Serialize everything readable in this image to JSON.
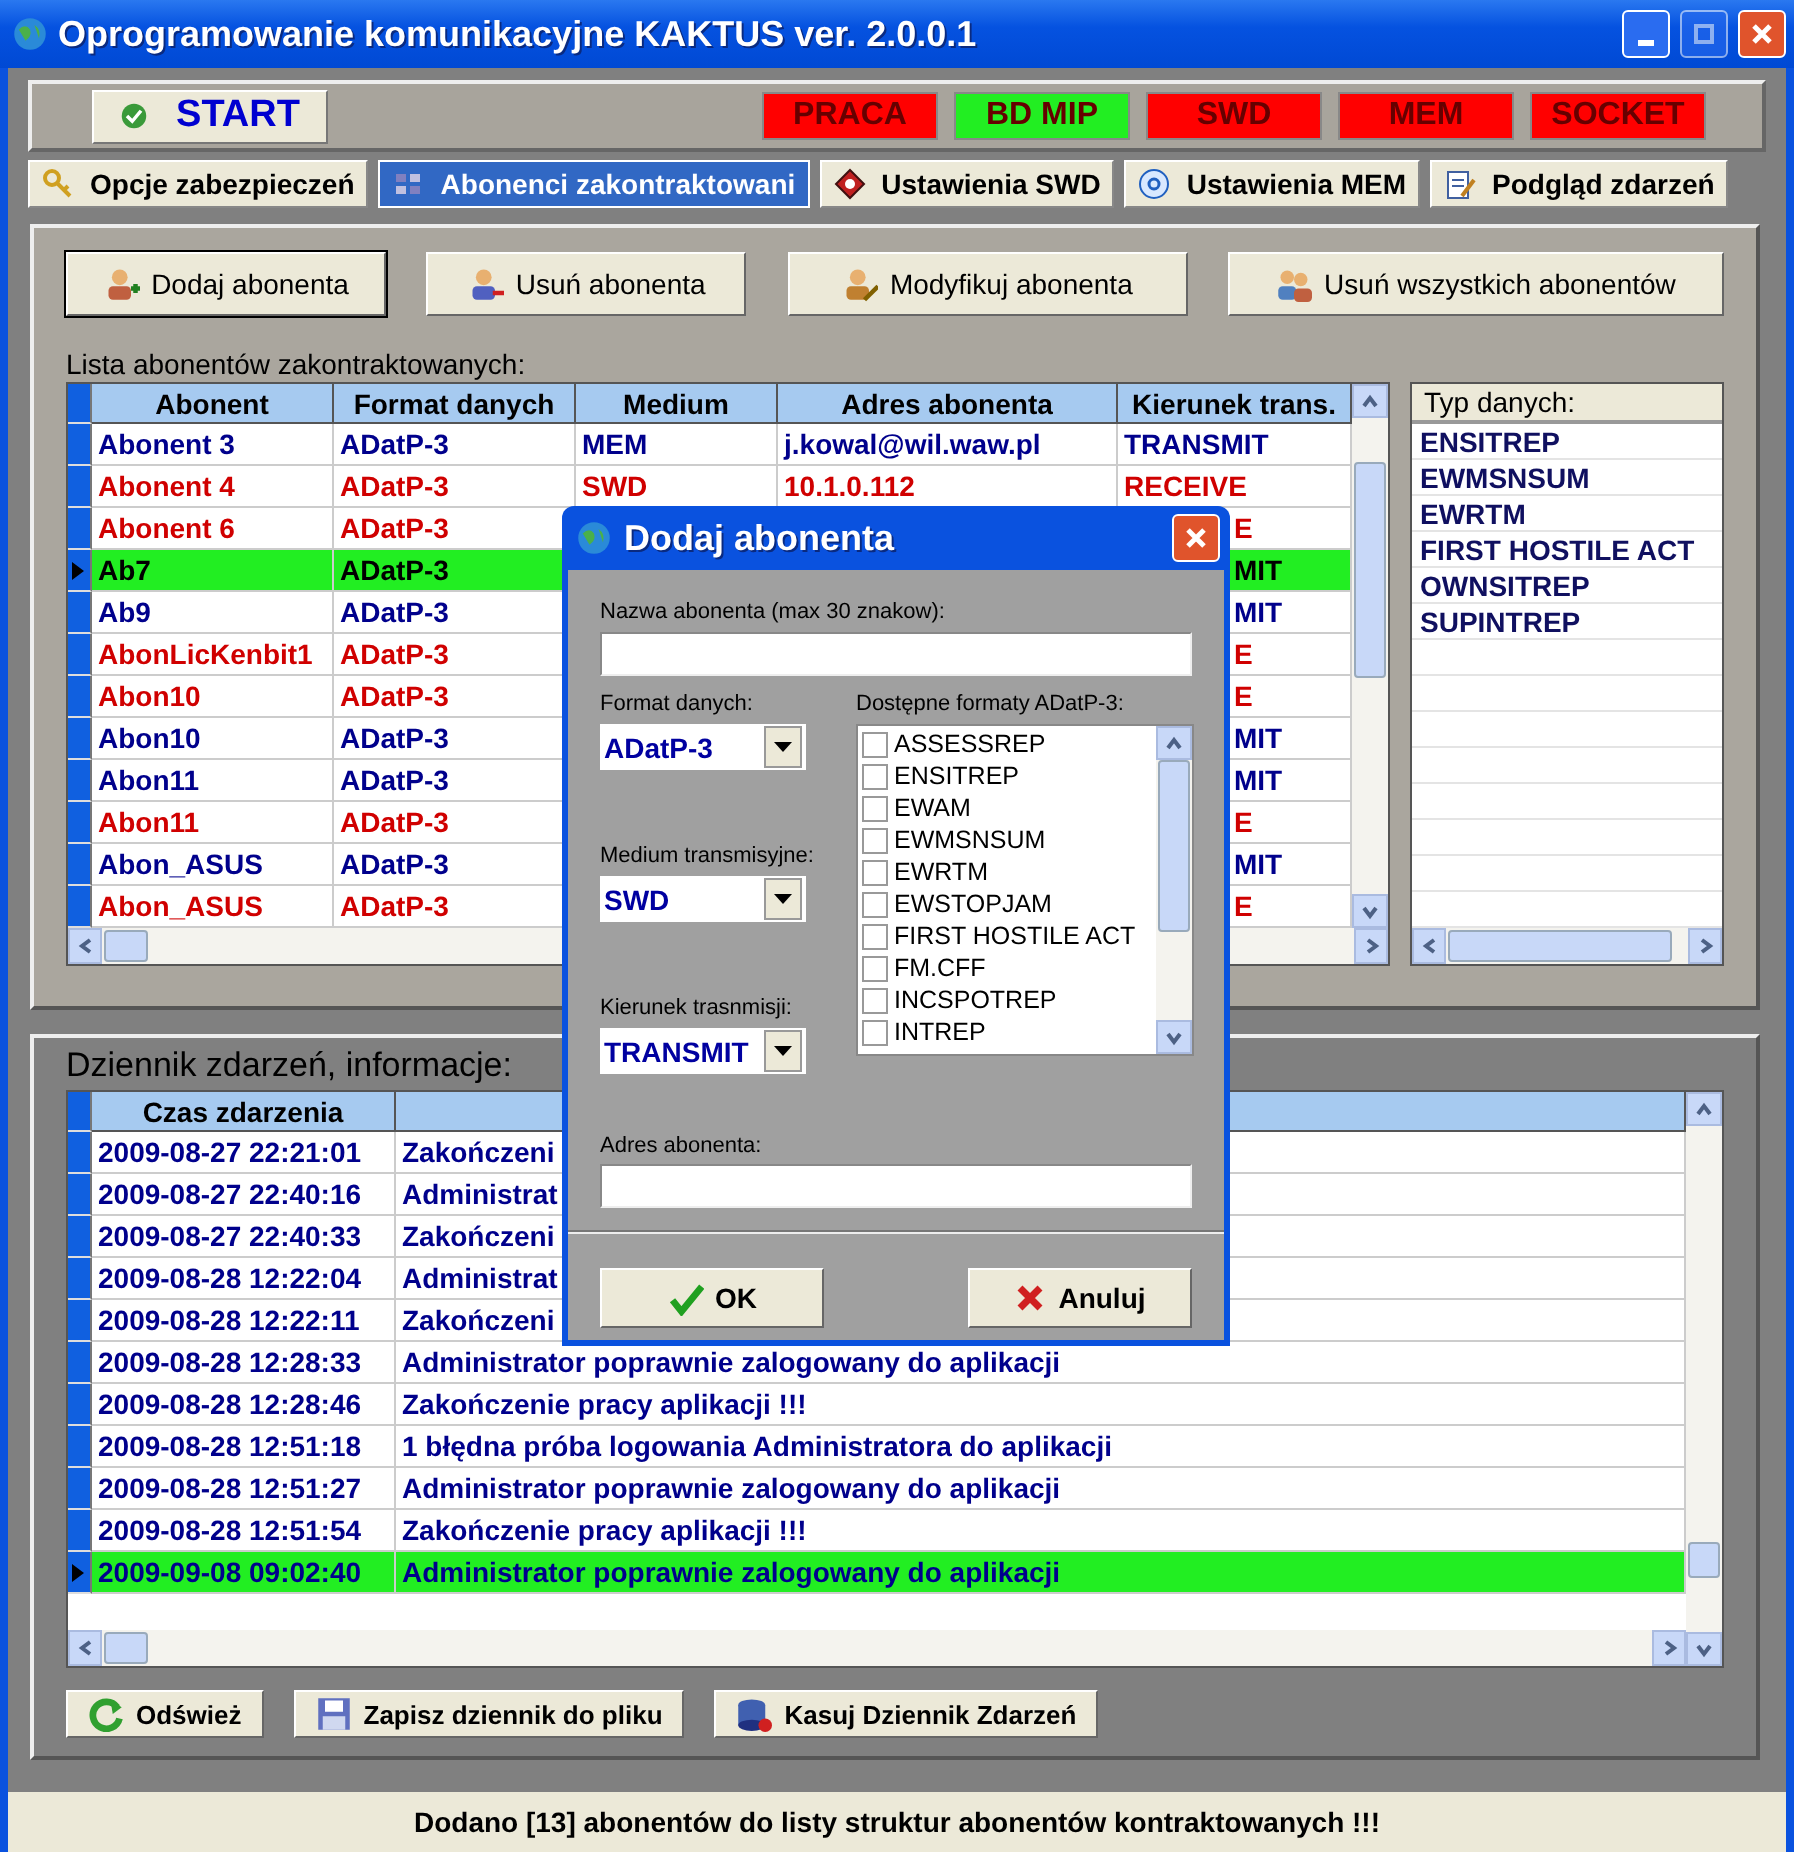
{
  "window": {
    "title": "Oprogramowanie komunikacyjne KAKTUS ver. 2.0.0.1"
  },
  "toolbar": {
    "start_button": "START",
    "indicators": [
      {
        "label": "PRACA",
        "active": false
      },
      {
        "label": "BD MIP",
        "active": true
      },
      {
        "label": "SWD",
        "active": false
      },
      {
        "label": "MEM",
        "active": false
      },
      {
        "label": "SOCKET",
        "active": false
      }
    ]
  },
  "tabs": [
    {
      "label": "Opcje zabezpieczeń",
      "selected": false
    },
    {
      "label": "Abonenci zakontraktowani",
      "selected": true
    },
    {
      "label": "Ustawienia SWD",
      "selected": false
    },
    {
      "label": "Ustawienia MEM",
      "selected": false
    },
    {
      "label": "Podgląd zdarzeń",
      "selected": false
    }
  ],
  "subscribers_panel": {
    "buttons": [
      "Dodaj abonenta",
      "Usuń abonenta",
      "Modyfikuj abonenta",
      "Usuń wszystkich abonentów"
    ],
    "list_label": "Lista abonentów zakontraktowanych:",
    "table": {
      "columns": [
        "Abonent",
        "Format danych",
        "Medium",
        "Adres abonenta",
        "Kierunek trans."
      ],
      "rows": [
        {
          "abonent": "Abonent 3",
          "format": "ADatP-3",
          "medium": "MEM",
          "address": "j.kowal@wil.waw.pl",
          "direction": "TRANSMIT",
          "color": "#00008c",
          "selected": false
        },
        {
          "abonent": "Abonent 4",
          "format": "ADatP-3",
          "medium": "SWD",
          "address": "10.1.0.112",
          "direction": "RECEIVE",
          "color": "#d00000",
          "selected": false
        },
        {
          "abonent": "Abonent 6",
          "format": "ADatP-3",
          "direction": "E",
          "color": "#d00000",
          "selected": false
        },
        {
          "abonent": "Ab7",
          "format": "ADatP-3",
          "direction": "MIT",
          "selected": true
        },
        {
          "abonent": "Ab9",
          "format": "ADatP-3",
          "direction": "MIT",
          "color": "#00008c",
          "selected": false
        },
        {
          "abonent": "AbonLicKenbit1",
          "format": "ADatP-3",
          "direction": "E",
          "color": "#d00000",
          "selected": false
        },
        {
          "abonent": "Abon10",
          "format": "ADatP-3",
          "direction": "E",
          "color": "#d00000",
          "selected": false
        },
        {
          "abonent": "Abon10",
          "format": "ADatP-3",
          "direction": "MIT",
          "color": "#00008c",
          "selected": false
        },
        {
          "abonent": "Abon11",
          "format": "ADatP-3",
          "direction": "MIT",
          "color": "#00008c",
          "selected": false
        },
        {
          "abonent": "Abon11",
          "format": "ADatP-3",
          "direction": "E",
          "color": "#d00000",
          "selected": false
        },
        {
          "abonent": "Abon_ASUS",
          "format": "ADatP-3",
          "direction": "MIT",
          "color": "#00008c",
          "selected": false
        },
        {
          "abonent": "Abon_ASUS",
          "format": "ADatP-3",
          "direction": "E",
          "color": "#d00000",
          "selected": false
        }
      ]
    },
    "data_types": {
      "title": "Typ danych:",
      "items": [
        "ENSITREP",
        "EWMSNSUM",
        "EWRTM",
        "FIRST HOSTILE ACT",
        "OWNSITREP",
        "SUPINTREP"
      ]
    }
  },
  "log_panel": {
    "title": "Dziennik zdarzeń, informacje:",
    "table": {
      "columns": [
        "Czas zdarzenia"
      ],
      "rows": [
        {
          "time": "2009-08-27 22:21:01",
          "message": "Zakończeni",
          "selected": false
        },
        {
          "time": "2009-08-27 22:40:16",
          "message": "Administrat",
          "selected": false
        },
        {
          "time": "2009-08-27 22:40:33",
          "message": "Zakończeni",
          "selected": false
        },
        {
          "time": "2009-08-28 12:22:04",
          "message": "Administrat",
          "selected": false
        },
        {
          "time": "2009-08-28 12:22:11",
          "message": "Zakończeni",
          "selected": false
        },
        {
          "time": "2009-08-28 12:28:33",
          "message": "Administrator poprawnie zalogowany do aplikacji",
          "selected": false
        },
        {
          "time": "2009-08-28 12:28:46",
          "message": "Zakończenie pracy aplikacji !!!",
          "selected": false
        },
        {
          "time": "2009-08-28 12:51:18",
          "message": "1 błędna próba logowania Administratora do aplikacji",
          "selected": false
        },
        {
          "time": "2009-08-28 12:51:27",
          "message": "Administrator poprawnie zalogowany do aplikacji",
          "selected": false
        },
        {
          "time": "2009-08-28 12:51:54",
          "message": "Zakończenie pracy aplikacji !!!",
          "selected": false
        },
        {
          "time": "2009-09-08 09:02:40",
          "message": "Administrator poprawnie zalogowany do aplikacji",
          "selected": true
        }
      ]
    },
    "buttons": [
      "Odśwież",
      "Zapisz dziennik do pliku",
      "Kasuj Dziennik Zdarzeń"
    ]
  },
  "status_bar": "Dodano [13] abonentów do listy struktur abonentów kontraktowanych !!!",
  "dialog": {
    "title": "Dodaj abonenta",
    "name_label": "Nazwa abonenta (max 30 znakow):",
    "format_label": "Format danych:",
    "format_value": "ADatP-3",
    "formats_label": "Dostępne formaty ADatP-3:",
    "formats": [
      {
        "label": "ASSESSREP",
        "checked": false
      },
      {
        "label": "ENSITREP",
        "checked": false
      },
      {
        "label": "EWAM",
        "checked": false
      },
      {
        "label": "EWMSNSUM",
        "checked": false
      },
      {
        "label": "EWRTM",
        "checked": false
      },
      {
        "label": "EWSTOPJAM",
        "checked": false
      },
      {
        "label": "FIRST HOSTILE ACT",
        "checked": false
      },
      {
        "label": "FM.CFF",
        "checked": false
      },
      {
        "label": "INCSPOTREP",
        "checked": false
      },
      {
        "label": "INTREP",
        "checked": false
      }
    ],
    "medium_label": "Medium transmisyjne:",
    "medium_value": "SWD",
    "direction_label": "Kierunek trasnmisji:",
    "direction_value": "TRANSMIT",
    "address_label": "Adres abonenta:",
    "ok_button": "OK",
    "cancel_button": "Anuluj"
  }
}
